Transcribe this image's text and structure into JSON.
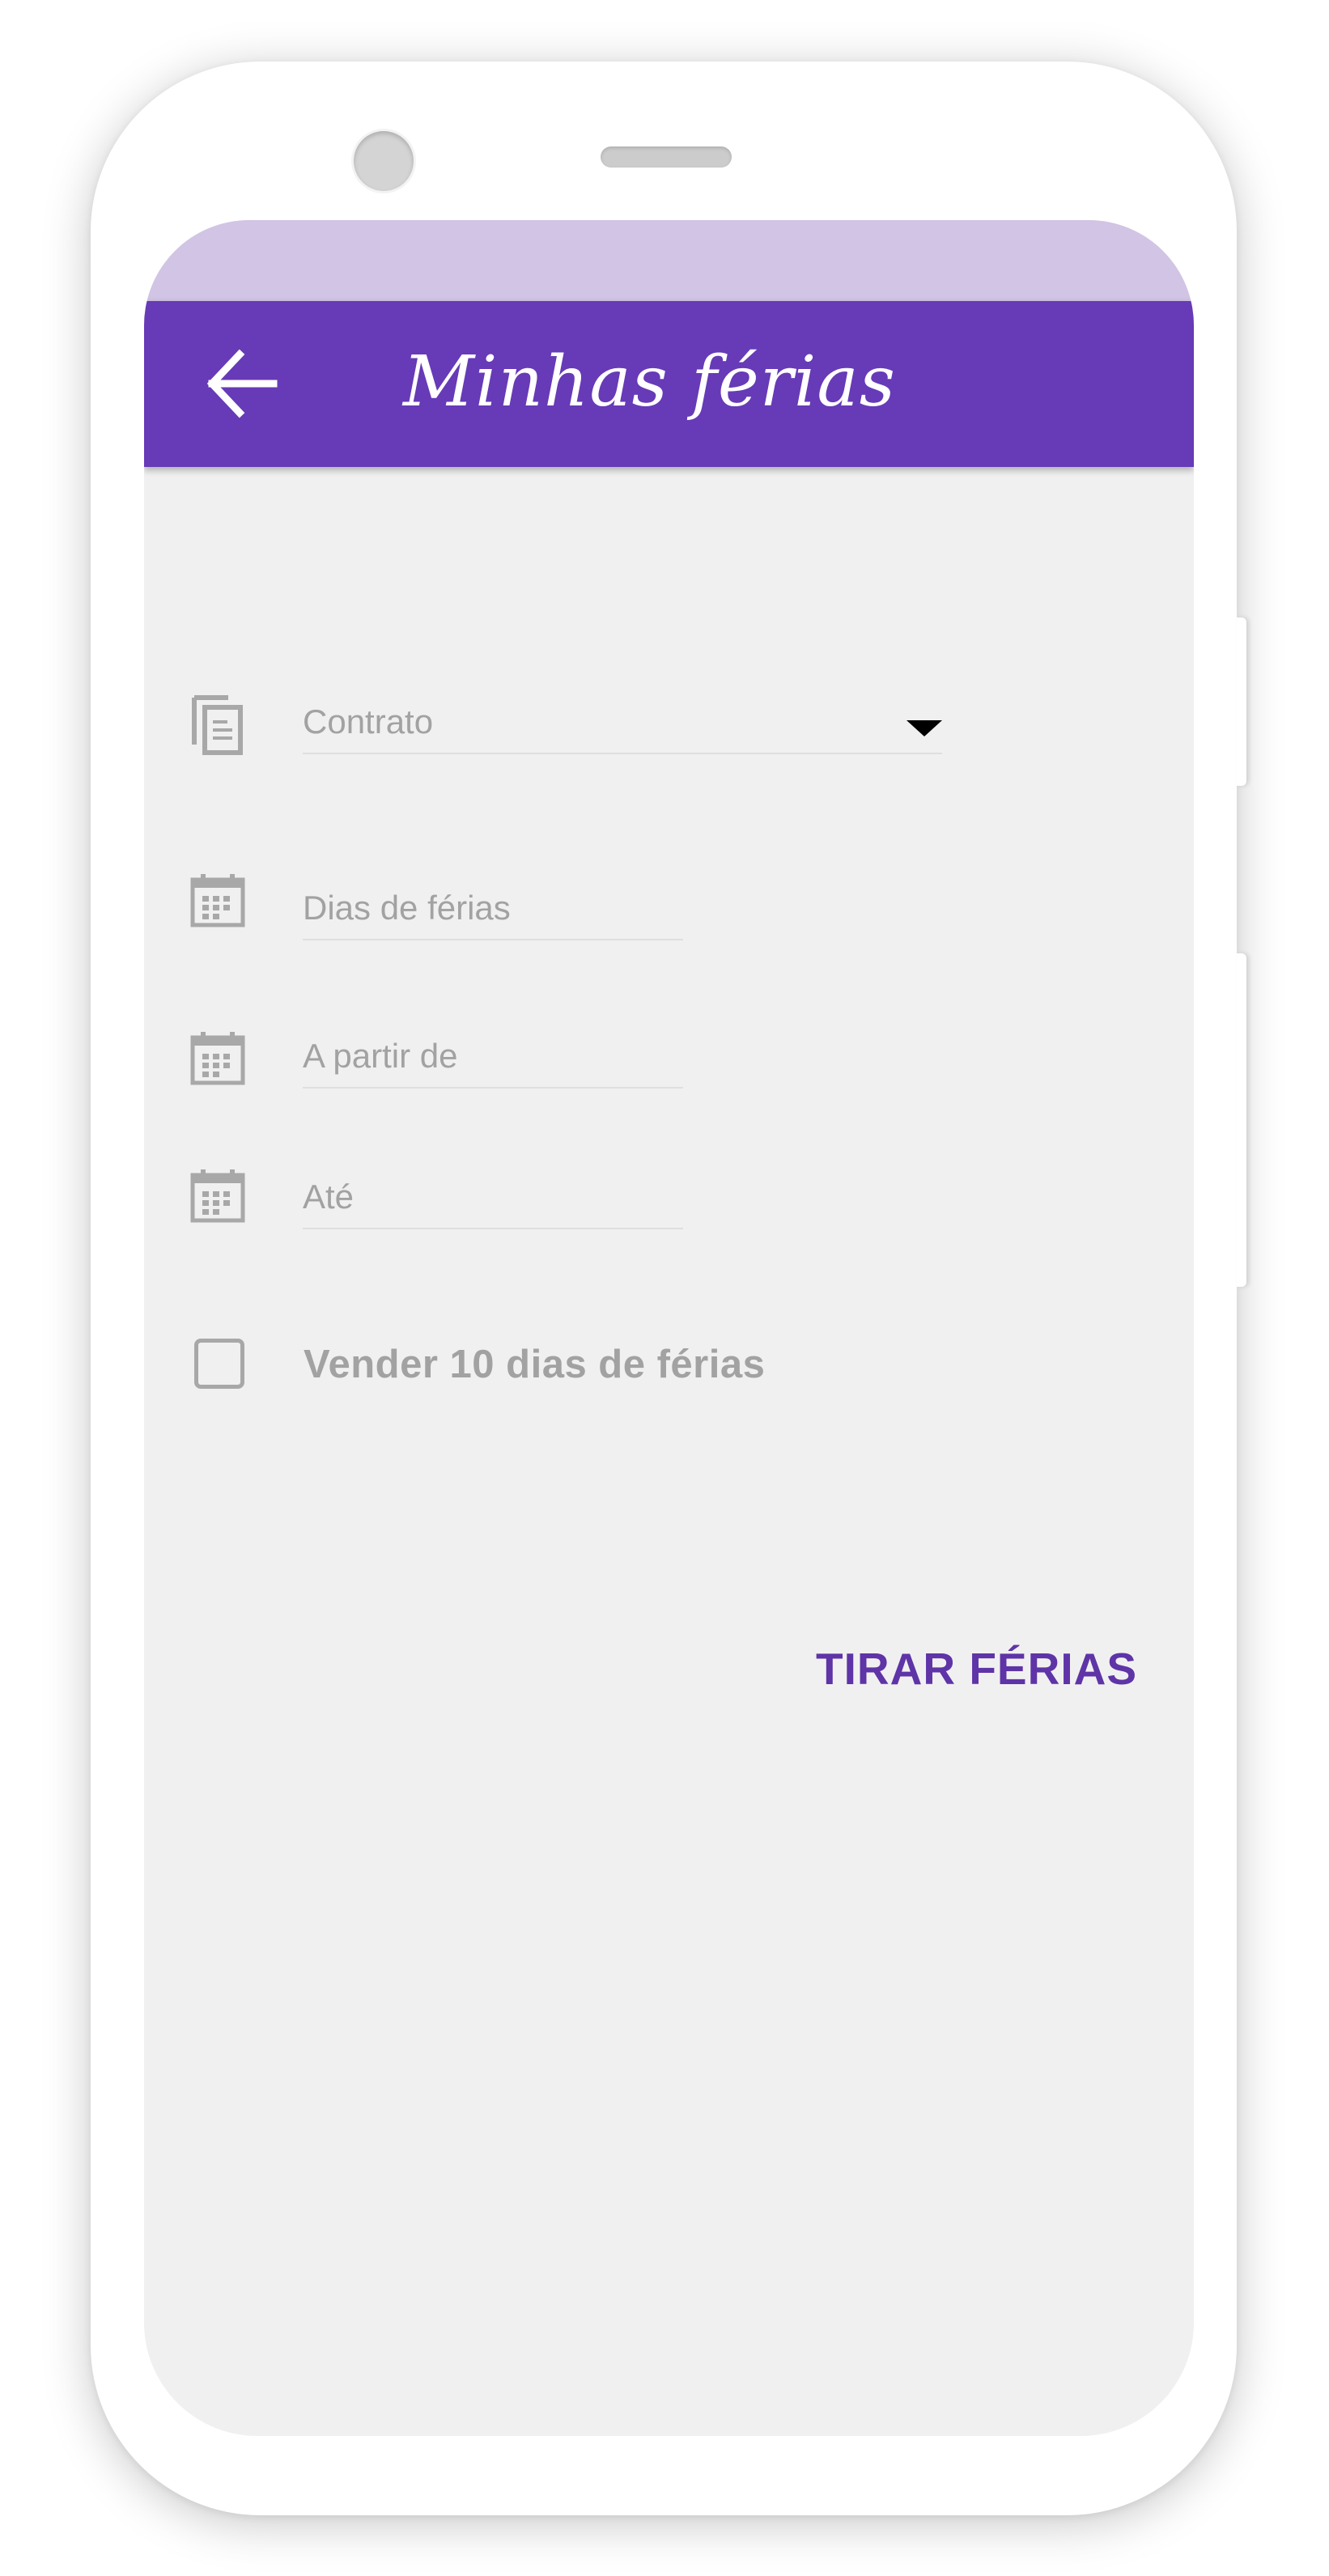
{
  "app_bar": {
    "title": "Minhas férias",
    "back_icon": "arrow-left-icon",
    "color": "#673ab7",
    "status_bar_color": "#d1c4e4"
  },
  "form": {
    "contract": {
      "label": "Contrato",
      "icon": "copy-document-icon",
      "type": "dropdown"
    },
    "vacation_days": {
      "label": "Dias de férias",
      "icon": "calendar-icon"
    },
    "start_date": {
      "label": "A partir de",
      "icon": "calendar-icon"
    },
    "end_date": {
      "label": "Até",
      "icon": "calendar-icon"
    },
    "sell_days": {
      "label": "Vender 10 dias de férias",
      "checked": false
    }
  },
  "actions": {
    "submit_label": "TIRAR FÉRIAS",
    "accent": "#5e34a7"
  },
  "background": "#f1f0f1"
}
